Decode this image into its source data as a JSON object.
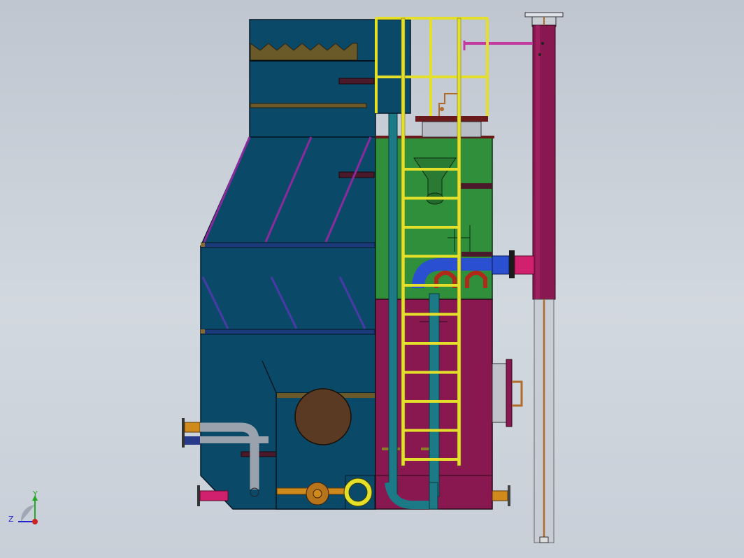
{
  "view": {
    "triad": {
      "y_label": "Y",
      "z_label": "Z"
    }
  },
  "colors": {
    "tank_blue": "#0a4a68",
    "tank_blue_dark": "#06324a",
    "chamber_green": "#2f8f3a",
    "chamber_magenta": "#8a1850",
    "ladder_yellow": "#e3df2a",
    "pipe_orange": "#d08a1c",
    "pipe_grey": "#9aa3ad",
    "pipe_blue": "#2a4fd0",
    "pipe_pink": "#d0206e",
    "baffle_purple": "#8a2a9c",
    "drum_brown": "#5a3a22",
    "teal_pipe": "#1c7a86",
    "red_bend": "#b02a1a"
  }
}
